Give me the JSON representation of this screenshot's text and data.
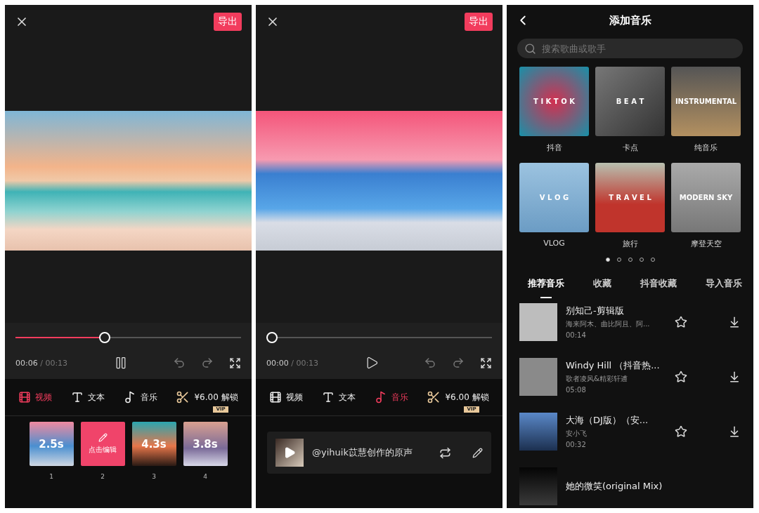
{
  "editor_screens": [
    {
      "export_button": "导出",
      "progress": {
        "level": 0.39
      },
      "time_current": "00:06",
      "time_total": " / 00:13",
      "playing": true,
      "tools": [
        {
          "kind": "video",
          "label": "视频",
          "selected": true
        },
        {
          "kind": "text",
          "label": "文本",
          "selected": false
        },
        {
          "kind": "music",
          "label": "音乐",
          "selected": false
        },
        {
          "kind": "unlock",
          "label": "¥6.00 解锁",
          "badge": "VIP",
          "selected": false
        }
      ],
      "panel": {
        "kind": "clips",
        "clips": [
          {
            "duration": "2.5s",
            "number": "1",
            "selected": false
          },
          {
            "label": "点击编辑",
            "number": "2",
            "selected": true
          },
          {
            "duration": "4.3s",
            "number": "3",
            "selected": false
          },
          {
            "duration": "3.8s",
            "number": "4",
            "selected": false
          }
        ]
      }
    },
    {
      "export_button": "导出",
      "progress": {
        "level": 0
      },
      "time_current": "00:00",
      "time_total": " / 00:13",
      "playing": false,
      "tools": [
        {
          "kind": "video",
          "label": "视频",
          "selected": false
        },
        {
          "kind": "text",
          "label": "文本",
          "selected": false
        },
        {
          "kind": "music",
          "label": "音乐",
          "selected": true
        },
        {
          "kind": "unlock",
          "label": "¥6.00 解锁",
          "badge": "VIP",
          "selected": false
        }
      ],
      "panel": {
        "kind": "audio",
        "track": "@yihuik苡慧创作的原声"
      }
    }
  ],
  "music_screen": {
    "title": "添加音乐",
    "search": {
      "placeholder": "搜索歌曲或歌手"
    },
    "categories": [
      {
        "cover_title": "T I K T O K",
        "label": "抖音"
      },
      {
        "cover_title": "B E A T",
        "label": "卡点"
      },
      {
        "cover_title": "INSTRUMENTAL",
        "label": "纯音乐"
      },
      {
        "cover_title": "V L O G",
        "label": "VLOG"
      },
      {
        "cover_title": "T R A V E L",
        "label": "旅行"
      },
      {
        "cover_title": "MODERN SKY",
        "label": "摩登天空"
      }
    ],
    "page_dots": [
      {
        "selected": true
      },
      {
        "selected": false
      },
      {
        "selected": false
      },
      {
        "selected": false
      },
      {
        "selected": false
      }
    ],
    "tabs": [
      {
        "label": "推荐音乐",
        "selected": true
      },
      {
        "label": "收藏",
        "selected": false
      },
      {
        "label": "抖音收藏",
        "selected": false
      },
      {
        "label": "导入音乐",
        "selected": false
      }
    ],
    "songs": [
      {
        "title": "别知己-剪辑版",
        "artist": "海来阿木、曲比阿且、阿...",
        "duration": "00:14"
      },
      {
        "title": "Windy Hill （抖音热...",
        "artist": "歌者凌风&精彩轩逋",
        "duration": "05:08"
      },
      {
        "title": "大海（DJ版）（安...",
        "artist": "安小飞",
        "duration": "00:32"
      },
      {
        "title": "她的微笑(original Mix)"
      }
    ]
  }
}
